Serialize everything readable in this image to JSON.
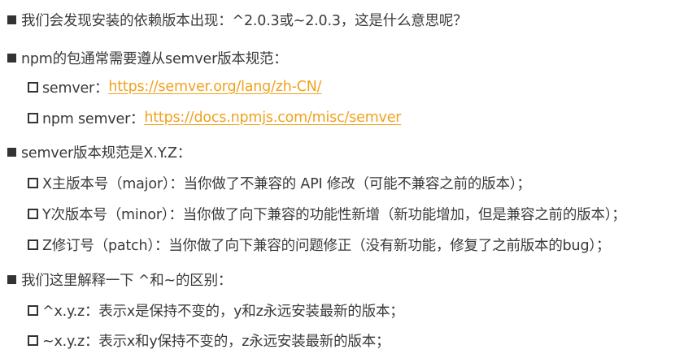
{
  "colors": {
    "text": "#3a3a3a",
    "bullet": "#333333",
    "link": "#f0a21c",
    "background": "#ffffff"
  },
  "lines": [
    {
      "level": 1,
      "text": "我们会发现安装的依赖版本出现：^2.0.3或~2.0.3，这是什么意思呢？"
    },
    {
      "level": 1,
      "text": "npm的包通常需要遵从semver版本规范："
    },
    {
      "level": 2,
      "text": "semver：",
      "link": "https://semver.org/lang/zh-CN/"
    },
    {
      "level": 2,
      "text": "npm semver：",
      "link": "https://docs.npmjs.com/misc/semver"
    },
    {
      "level": 1,
      "text": "semver版本规范是X.Y.Z："
    },
    {
      "level": 2,
      "text": "X主版本号（major）：当你做了不兼容的 API 修改（可能不兼容之前的版本）；"
    },
    {
      "level": 2,
      "text": "Y次版本号（minor）：当你做了向下兼容的功能性新增（新功能增加，但是兼容之前的版本）；"
    },
    {
      "level": 2,
      "text": "Z修订号（patch）：当你做了向下兼容的问题修正（没有新功能，修复了之前版本的bug）；"
    },
    {
      "level": 1,
      "text": "我们这里解释一下 ^和~的区别："
    },
    {
      "level": 2,
      "text": "^x.y.z：表示x是保持不变的，y和z永远安装最新的版本；"
    },
    {
      "level": 2,
      "text": "~x.y.z：表示x和y保持不变的，z永远安装最新的版本；"
    }
  ]
}
